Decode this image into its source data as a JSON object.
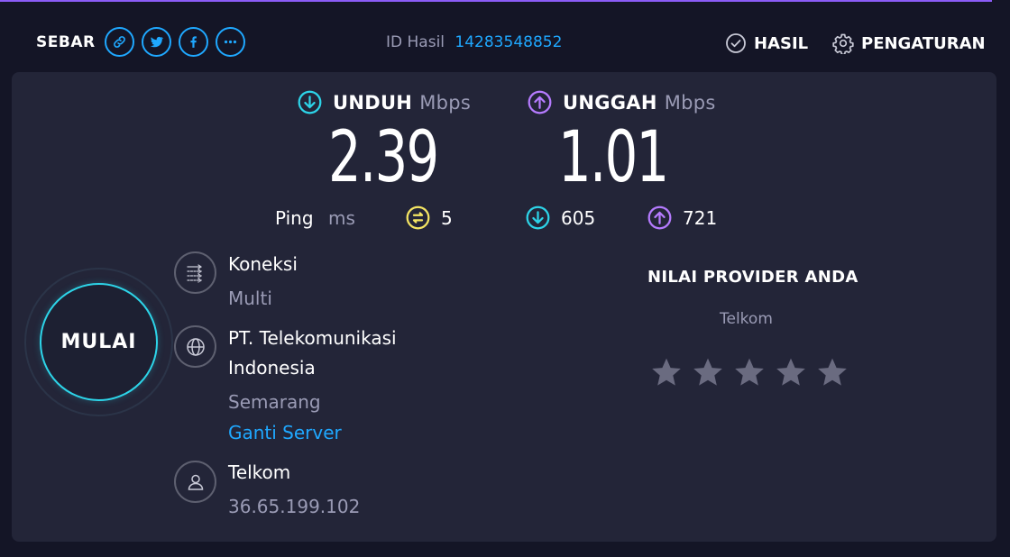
{
  "header": {
    "share_label": "SEBAR",
    "share_buttons": [
      "link-icon",
      "twitter-icon",
      "facebook-icon",
      "more-icon"
    ],
    "result_id_label": "ID Hasil",
    "result_id_value": "14283548852",
    "results_label": "HASIL",
    "settings_label": "PENGATURAN"
  },
  "colors": {
    "accent_blue": "#1fa8ff",
    "download_cyan": "#2dd4e8",
    "upload_purple": "#b57bff",
    "ping_yellow": "#f5e663",
    "panel_bg": "#232538",
    "page_bg": "#141526"
  },
  "download": {
    "label": "UNDUH",
    "unit": "Mbps",
    "value": "2.39"
  },
  "upload": {
    "label": "UNGGAH",
    "unit": "Mbps",
    "value": "1.01"
  },
  "ping": {
    "label": "Ping",
    "unit": "ms",
    "idle": "5",
    "download": "605",
    "upload": "721"
  },
  "start_button": {
    "label": "MULAI"
  },
  "connection": {
    "label": "Koneksi",
    "value": "Multi"
  },
  "server": {
    "name_line1": "PT. Telekomunikasi",
    "name_line2": "Indonesia",
    "location": "Semarang",
    "change_label": "Ganti Server"
  },
  "provider": {
    "name": "Telkom",
    "ip": "36.65.199.102"
  },
  "rating": {
    "title": "NILAI PROVIDER ANDA",
    "provider": "Telkom",
    "stars": 5,
    "selected": 0
  }
}
